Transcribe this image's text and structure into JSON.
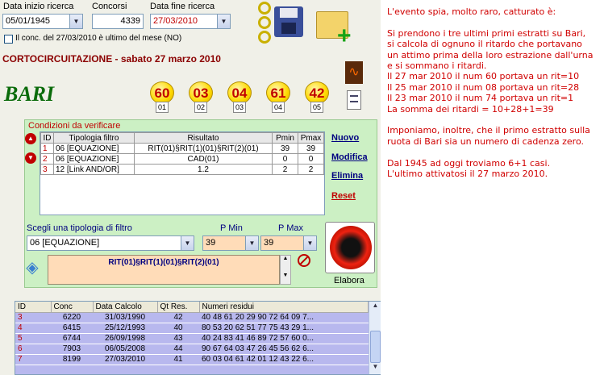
{
  "header": {
    "data_inizio_label": "Data inizio ricerca",
    "data_inizio_value": "05/01/1945",
    "concorsi_label": "Concorsi",
    "concorsi_value": "4339",
    "data_fine_label": "Data fine ricerca",
    "data_fine_value": "27/03/2010",
    "check_label": "Il conc. del 27/03/2010 è ultimo del mese (NO)"
  },
  "title": "CORTOCIRCUITAZIONE",
  "title_date": " - sabato 27 marzo 2010",
  "wheel": "BARI",
  "numbers": [
    {
      "num": "60",
      "pos": "01"
    },
    {
      "num": "03",
      "pos": "02"
    },
    {
      "num": "04",
      "pos": "03"
    },
    {
      "num": "61",
      "pos": "04"
    },
    {
      "num": "42",
      "pos": "05"
    }
  ],
  "conditions": {
    "legend": "Condizioni da verificare",
    "columns": [
      "ID",
      "Tipologia filtro",
      "Risultato",
      "Pmin",
      "Pmax"
    ],
    "rows": [
      {
        "id": "1",
        "tipo": "06 [EQUAZIONE]",
        "ris": "RIT(01)§RIT(1)(01)§RIT(2)(01)",
        "pmin": "39",
        "pmax": "39"
      },
      {
        "id": "2",
        "tipo": "06 [EQUAZIONE]",
        "ris": "CAD(01)",
        "pmin": "0",
        "pmax": "0"
      },
      {
        "id": "3",
        "tipo": "12 [Link AND/OR]",
        "ris": "1.2",
        "pmin": "2",
        "pmax": "2"
      }
    ],
    "links": {
      "nuovo": "Nuovo",
      "modifica": "Modifica",
      "elimina": "Elimina",
      "reset": "Reset"
    }
  },
  "filter": {
    "scegli_label": "Scegli una tipologia di filtro",
    "tipo_value": "06 [EQUAZIONE]",
    "pmin_label": "P Min",
    "pmin_value": "39",
    "pmax_label": "P Max",
    "pmax_value": "39",
    "formula": "RIT(01)§RIT(1)(01)§RIT(2)(01)",
    "elabora": "Elabora"
  },
  "results": {
    "columns": [
      "ID",
      "Conc",
      "Data Calcolo",
      "Qt Res.",
      "Numeri residui"
    ],
    "rows": [
      {
        "id": "3",
        "conc": "6220",
        "data": "31/03/1990",
        "qt": "42",
        "num": "40 48 61 20 29 90 72 64 09 7..."
      },
      {
        "id": "4",
        "conc": "6415",
        "data": "25/12/1993",
        "qt": "40",
        "num": "80 53 20 62 51 77 75 43 29 1..."
      },
      {
        "id": "5",
        "conc": "6744",
        "data": "26/09/1998",
        "qt": "43",
        "num": "40 24 83 41 46 89 72 57 60 0..."
      },
      {
        "id": "6",
        "conc": "7903",
        "data": "06/05/2008",
        "qt": "44",
        "num": "90 67 64 03 47 26 45 56 62 6..."
      },
      {
        "id": "7",
        "conc": "8199",
        "data": "27/03/2010",
        "qt": "41",
        "num": "60 03 04 61 42 01 12 43 22 6..."
      }
    ]
  },
  "notes": [
    "L'evento spia, molto raro, catturato è:",
    "",
    "Si prendono i tre ultimi primi estratti su Bari,",
    "si calcola di ognuno il ritardo che portavano",
    "un attimo prima della loro estrazione dall'urna",
    "e si sommano i ritardi.",
    "Il 27 mar 2010 il num 60 portava un rit=10",
    "Il 25 mar 2010 il num 08 portava un rit=28",
    "Il 23 mar 2010 il num 74 portava un rit=1",
    "La somma dei ritardi = 10+28+1=39",
    "",
    "Imponiamo, inoltre, che il primo estratto sulla",
    "ruota di Bari sia un numero di cadenza zero.",
    "",
    "Dal 1945 ad oggi troviamo 6+1 casi.",
    "L'ultimo attivatosi il 27 marzo 2010."
  ]
}
